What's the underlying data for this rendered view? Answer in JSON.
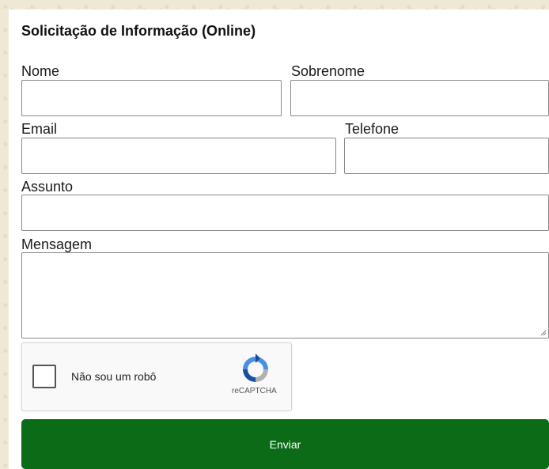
{
  "form": {
    "title": "Solicitação de Informação (Online)",
    "fields": {
      "nome": {
        "label": "Nome",
        "value": "",
        "placeholder": ""
      },
      "sobrenome": {
        "label": "Sobrenome",
        "value": "",
        "placeholder": ""
      },
      "email": {
        "label": "Email",
        "value": "",
        "placeholder": ""
      },
      "telefone": {
        "label": "Telefone",
        "value": "",
        "placeholder": ""
      },
      "assunto": {
        "label": "Assunto",
        "value": "",
        "placeholder": ""
      },
      "mensagem": {
        "label": "Mensagem",
        "value": "",
        "placeholder": ""
      }
    },
    "recaptcha": {
      "label": "Não sou um robô",
      "brand": "reCAPTCHA",
      "checked": false
    },
    "submit_label": "Enviar"
  },
  "colors": {
    "submit_bg": "#0b6b16",
    "page_bg": "#efe8d4"
  }
}
